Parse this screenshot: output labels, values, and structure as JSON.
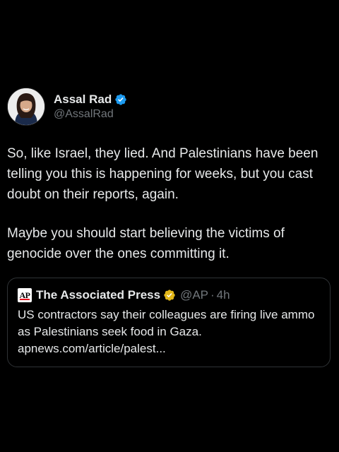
{
  "author": {
    "display_name": "Assal Rad",
    "handle": "@AssalRad",
    "avatar_icon": "profile-photo",
    "verified_icon": "blue-verified-badge-icon"
  },
  "tweet": {
    "paragraph_1": "So, like Israel, they lied. And Palestinians have been telling you this is happening for weeks, but you cast doubt on their reports, again.",
    "paragraph_2": "Maybe you should start believing the victims of genocide over the ones committing it."
  },
  "quoted_tweet": {
    "logo_text": "AP",
    "display_name": "The Associated Press",
    "verified_icon": "gold-verified-badge-icon",
    "handle": "@AP",
    "separator": "·",
    "time": "4h",
    "text": "US contractors say their colleagues are firing live ammo as Palestinians seek food in Gaza.",
    "link": "apnews.com/article/palest..."
  },
  "colors": {
    "background": "#000000",
    "text": "#e7e9ea",
    "secondary_text": "#71767b",
    "verified_blue": "#1d9bf0",
    "verified_gold": "#e2b719",
    "border": "#2f3336"
  }
}
